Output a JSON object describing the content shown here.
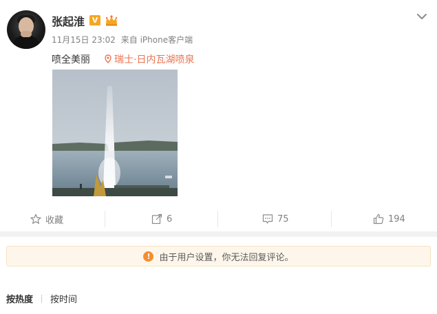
{
  "post": {
    "username": "张起淮",
    "verified_badge": "V",
    "timestamp": "11月15日 23:02",
    "source": "来自 iPhone客户端",
    "text": "喷全美丽",
    "location": "瑞士·日内瓦湖喷泉",
    "photo_alt": "日内瓦湖喷泉",
    "icons": {
      "menu": "chevron-down-icon",
      "location": "location-pin-icon"
    }
  },
  "actions": {
    "favorite_label": "收藏",
    "share_count": "6",
    "comment_count": "75",
    "like_count": "194"
  },
  "notice": {
    "icon_glyph": "!",
    "text": "由于用户设置，你无法回复评论。"
  },
  "comments": {
    "sort_hot": "按热度",
    "sort_time": "按时间"
  },
  "colors": {
    "accent": "#eb7350",
    "muted": "#808080",
    "notice_bg": "#fef6ea",
    "warning": "#f58e31",
    "badge": "#f6a623"
  }
}
